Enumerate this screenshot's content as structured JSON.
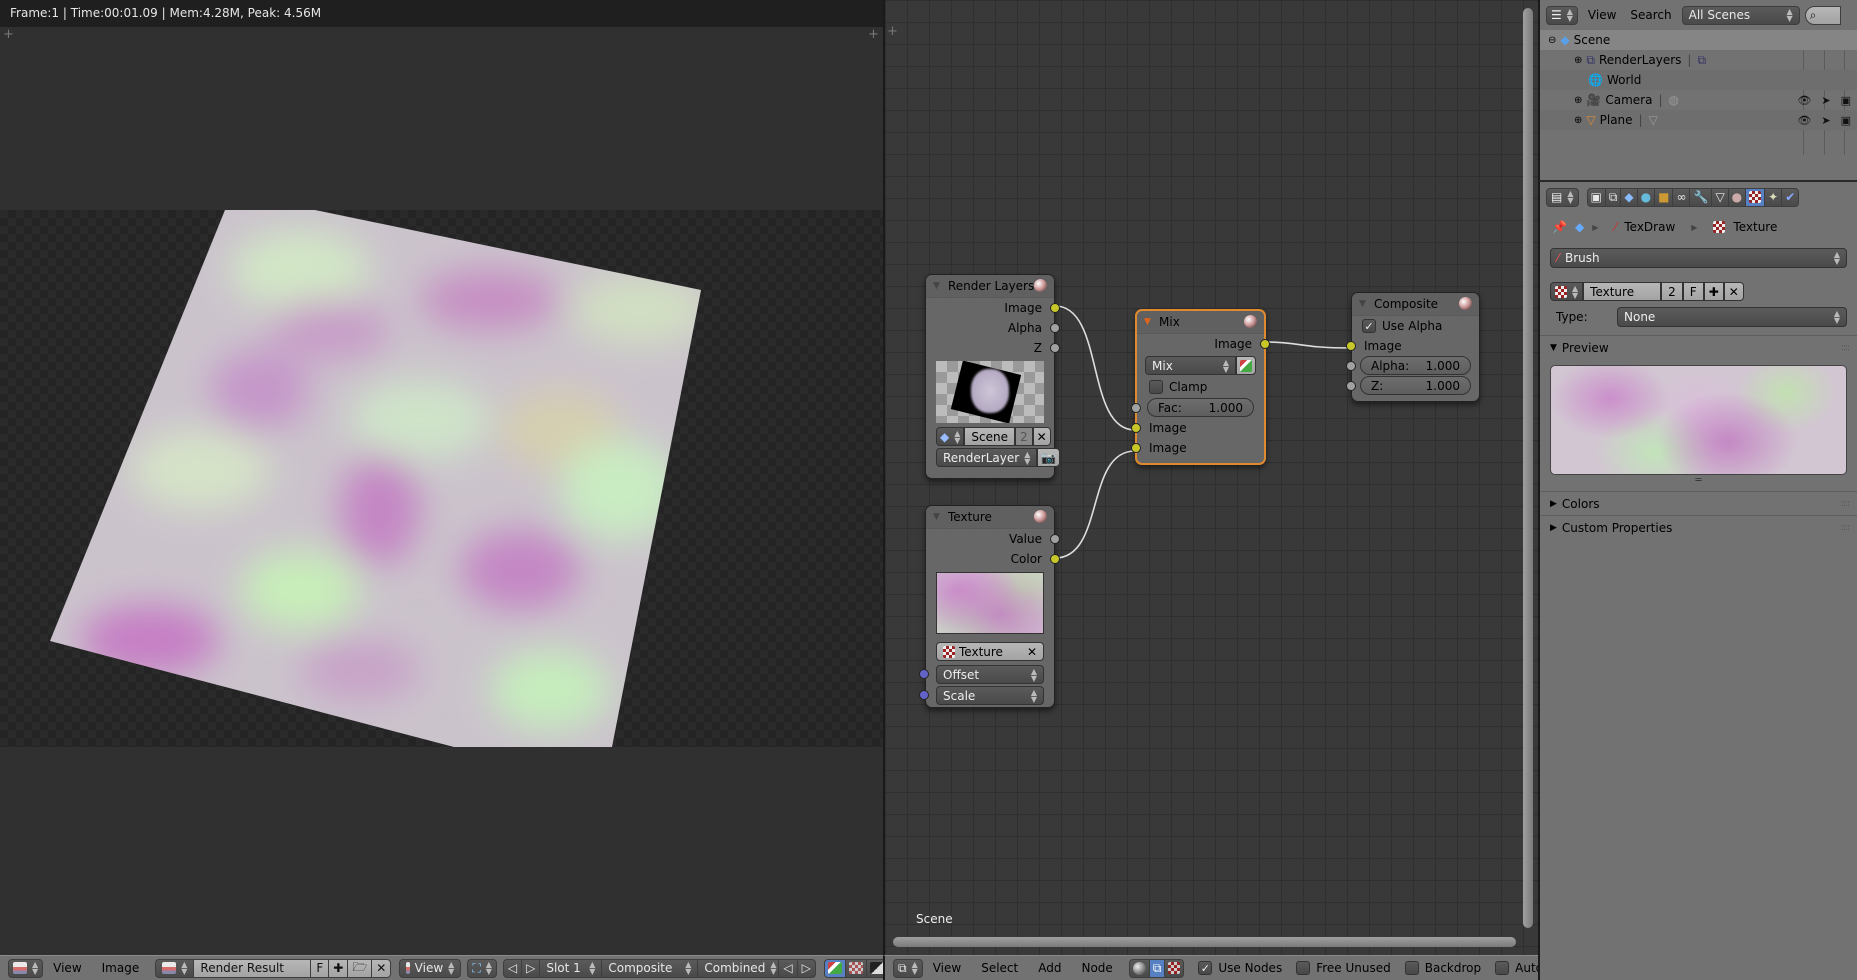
{
  "image_editor": {
    "info_bar": "Frame:1 | Time:00:01.09 | Mem:4.28M, Peak: 4.56M",
    "header": {
      "menus": [
        "View",
        "Image"
      ],
      "image_name": "Render Result",
      "fake_user": "F",
      "view_label": "View",
      "slot": "Slot 1",
      "layer": "Composite",
      "pass": "Combined"
    }
  },
  "node_editor": {
    "scene_label": "Scene",
    "header": {
      "menus": [
        "View",
        "Select",
        "Add",
        "Node"
      ],
      "use_nodes": {
        "label": "Use Nodes",
        "checked": true
      },
      "free_unused": {
        "label": "Free Unused",
        "checked": false
      },
      "backdrop": {
        "label": "Backdrop",
        "checked": false
      },
      "auto_render": {
        "label": "Auto Render",
        "checked": false
      }
    },
    "nodes": {
      "render_layers": {
        "title": "Render Layers",
        "outputs": [
          "Image",
          "Alpha",
          "Z"
        ],
        "scene": "Scene",
        "scene_users": "2",
        "layer": "RenderLayer"
      },
      "texture": {
        "title": "Texture",
        "outputs": [
          "Value",
          "Color"
        ],
        "texture_name": "Texture",
        "inputs": [
          "Offset",
          "Scale"
        ]
      },
      "mix": {
        "title": "Mix",
        "output": "Image",
        "blend_mode": "Mix",
        "clamp_label": "Clamp",
        "fac_label": "Fac:",
        "fac_value": "1.000",
        "inputs": [
          "Image",
          "Image"
        ]
      },
      "composite": {
        "title": "Composite",
        "use_alpha_label": "Use Alpha",
        "input_image": "Image",
        "alpha_label": "Alpha:",
        "alpha_value": "1.000",
        "z_label": "Z:",
        "z_value": "1.000"
      }
    }
  },
  "outliner": {
    "menus": [
      "View",
      "Search"
    ],
    "display_mode": "All Scenes",
    "items": [
      {
        "label": "Scene",
        "level": 0
      },
      {
        "label": "RenderLayers",
        "level": 1
      },
      {
        "label": "World",
        "level": 1
      },
      {
        "label": "Camera",
        "level": 1
      },
      {
        "label": "Plane",
        "level": 1
      }
    ]
  },
  "properties": {
    "breadcrumb": [
      "TexDraw",
      "Texture"
    ],
    "context": "Brush",
    "texture_name": "Texture",
    "texture_users": "2",
    "fake_user": "F",
    "type_label": "Type:",
    "type_value": "None",
    "panels": {
      "preview": "Preview",
      "colors": "Colors",
      "custom_properties": "Custom Properties"
    }
  }
}
